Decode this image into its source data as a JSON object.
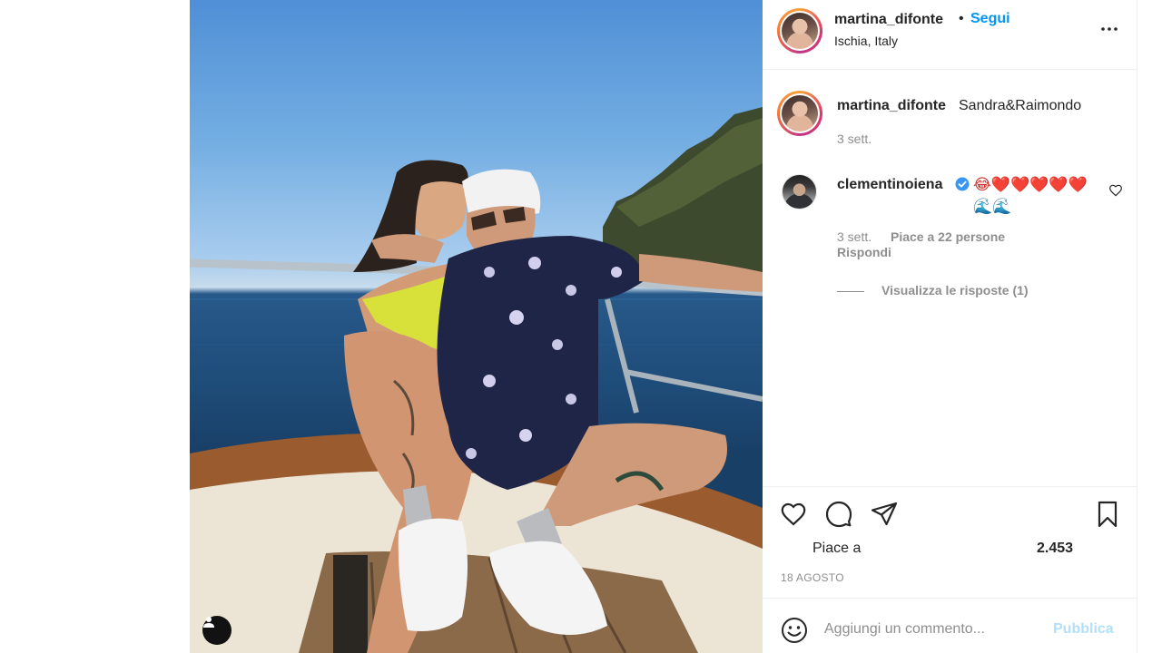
{
  "post": {
    "photo_alt": "Couple sitting on the bow of a boat at sea"
  },
  "header": {
    "username": "martina_difonte",
    "separator": "•",
    "follow_label": "Segui",
    "location": "Ischia, Italy",
    "more_label": "•••"
  },
  "caption": {
    "username": "martina_difonte",
    "text": "Sandra&Raimondo",
    "time": "3 sett."
  },
  "comment": {
    "username": "clementinoiena",
    "text": "😂❤️❤️❤️❤️❤️ 🌊🌊",
    "time": "3 sett.",
    "likes": "Piace a 22 persone",
    "reply_label": "Rispondi",
    "view_replies_label": "Visualizza le risposte (1)"
  },
  "stats": {
    "likes_prefix": "Piace a",
    "likes_count": "2.453",
    "date": "18 AGOSTO"
  },
  "composer": {
    "placeholder": "Aggiungi un commento...",
    "publish_label": "Pubblica"
  },
  "icons": {
    "like": "heart-icon",
    "comment": "comment-bubble-icon",
    "share": "paper-plane-icon",
    "save": "bookmark-icon",
    "more": "more-dots-icon",
    "emoji": "emoji-smile-icon",
    "tag": "user-tag-icon",
    "verified": "verified-badge-icon"
  },
  "colors": {
    "accent": "#0095f6",
    "publish_disabled": "#b2dffc",
    "muted": "#8e8e8e",
    "text": "#262626"
  }
}
